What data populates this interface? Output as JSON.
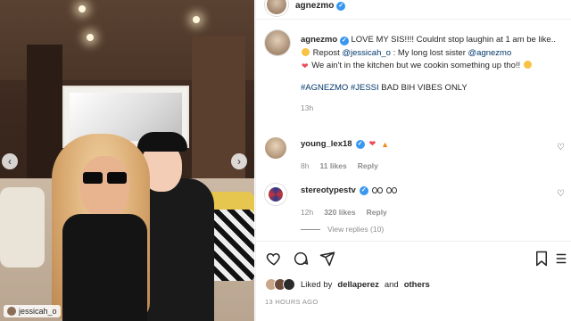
{
  "photo": {
    "tagged_user": "jessicah_o"
  },
  "header": {
    "username": "agnezmo"
  },
  "caption": {
    "username": "agnezmo",
    "line1": "LOVE MY SIS!!!! Couldnt stop laughin at 1 am be like..",
    "repost_prefix": "Repost",
    "repost_mention": "@jessicah_o",
    "repost_mid": ": My long lost sister",
    "repost_mention2": "@agnezmo",
    "line3": "We ain't in the kitchen but we cookin something up tho!!",
    "hashtag1": "#AGNEZMO",
    "hashtag2": "#JESSI",
    "tags_text": "BAD BIH VIBES ONLY",
    "time": "13h"
  },
  "comments": [
    {
      "username": "young_lex18",
      "time": "8h",
      "likes": "11 likes",
      "reply": "Reply"
    },
    {
      "username": "stereotypestv",
      "time": "12h",
      "likes": "320 likes",
      "reply": "Reply"
    }
  ],
  "view_replies": "View replies (10)",
  "liked_by": {
    "prefix": "Liked by",
    "user": "dellaperez",
    "and": "and",
    "others": "others"
  },
  "post_time": "13 HOURS AGO",
  "icons": {
    "verified": "verified-badge-icon",
    "heart": "heart-icon",
    "comment": "comment-icon",
    "share": "share-icon",
    "save": "bookmark-icon",
    "more": "more-icon"
  },
  "colors": {
    "link": "#00376b",
    "verified": "#3897f0",
    "muted": "#8e8e8e",
    "heart": "#ed4956"
  }
}
